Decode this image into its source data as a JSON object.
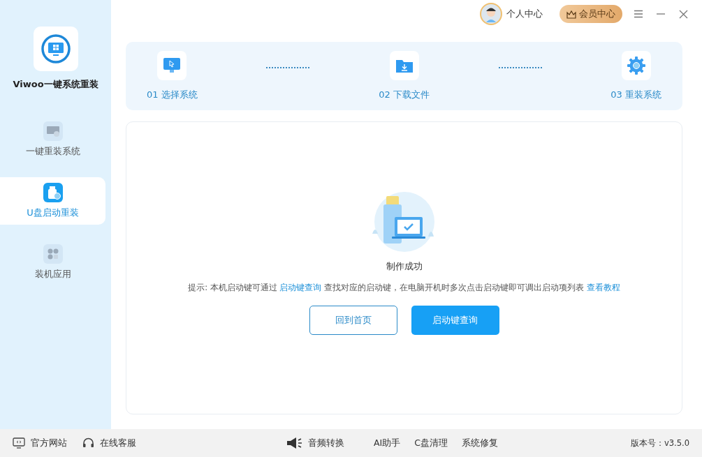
{
  "app": {
    "name": "Viwoo一键系统重装"
  },
  "sidebar": {
    "items": [
      {
        "kind": "reinstall",
        "label": "一键重装系统",
        "selected": false
      },
      {
        "kind": "usb",
        "label": "U盘启动重装",
        "selected": true
      },
      {
        "kind": "apps",
        "label": "装机应用",
        "selected": false
      }
    ]
  },
  "header": {
    "user": "个人中心",
    "vip": "会员中心"
  },
  "steps": [
    {
      "kind": "select",
      "label": "01 选择系统"
    },
    {
      "kind": "download",
      "label": "02 下载文件"
    },
    {
      "kind": "install",
      "label": "03 重装系统"
    }
  ],
  "result": {
    "title": "制作成功",
    "hint": {
      "prefix": "提示: 本机启动键可通过 ",
      "link": "启动键查询",
      "middle": " 查找对应的启动键，在电脑开机时多次点击启动键即可调出启动项列表 ",
      "tutorial": "查看教程"
    },
    "buttons": [
      {
        "kind": "outline",
        "label": "回到首页"
      },
      {
        "kind": "primary",
        "label": "启动键查询"
      }
    ]
  },
  "footer": {
    "left": [
      {
        "kind": "monitor",
        "label": "官方网站"
      },
      {
        "kind": "headset",
        "label": "在线客服"
      }
    ],
    "tools": [
      {
        "kind": "megaphone",
        "label": "音频转换"
      },
      {
        "kind": "plain",
        "label": "AI助手"
      },
      {
        "kind": "plain",
        "label": "C盘清理"
      },
      {
        "kind": "plain",
        "label": "系统修复"
      }
    ],
    "version": "版本号：v3.5.0"
  }
}
